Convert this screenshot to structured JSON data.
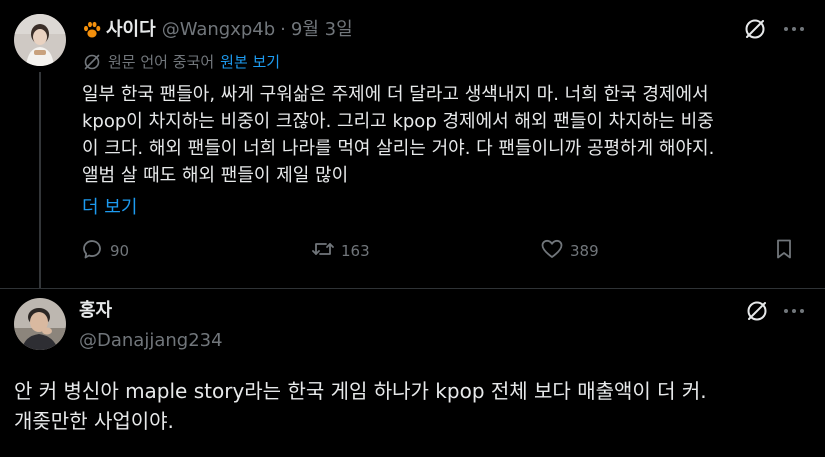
{
  "post1": {
    "author_name": "사이다",
    "author_handle": "@Wangxp4b",
    "separator": "·",
    "date": "9월 3일",
    "translation_note": "원문 언어 중국어",
    "show_original_label": "원본 보기",
    "text": "일부 한국 팬들아, 싸게 구워삶은 주제에 더 달라고 생색내지 마. 너희 한국 경제에서\nkpop이 차지하는 비중이 크잖아. 그리고 kpop 경제에서 해외 팬들이 차지하는 비중\n이 크다. 해외 팬들이 너희 나라를 먹여 살리는 거야. 다 팬들이니까 공평하게 해야지.\n앨범 살 때도 해외 팬들이 제일 많이",
    "show_more_label": "더 보기",
    "reply_count": "90",
    "retweet_count": "163",
    "like_count": "389"
  },
  "post2": {
    "author_name": "홍자",
    "author_handle": "@Danajjang234",
    "text": "안 커 병신아 maple story라는 한국 게임 하나가 kpop 전체 보다 매출액이 더 커.\n개좆만한 사업이야."
  },
  "icons": {
    "author_badge": "paw-icon",
    "grok": "grok-icon",
    "more": "more-icon",
    "translate": "translate-icon",
    "reply": "reply-icon",
    "retweet": "retweet-icon",
    "like": "heart-icon",
    "bookmark": "bookmark-icon"
  },
  "colors": {
    "background": "#000000",
    "text_primary": "#e7e9ea",
    "text_secondary": "#71767b",
    "link": "#1d9bf0",
    "badge_orange": "#f4900c",
    "divider": "#2f3336"
  }
}
